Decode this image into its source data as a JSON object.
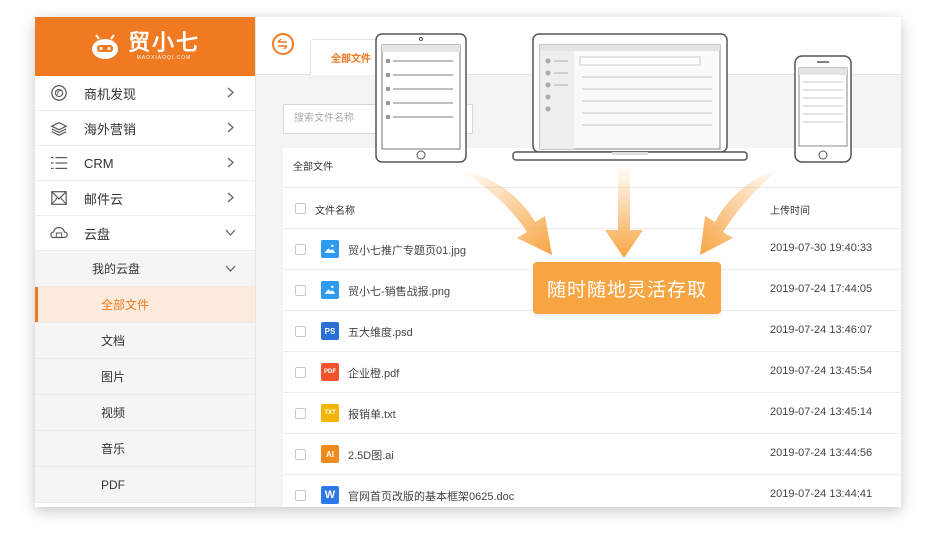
{
  "brand": {
    "name": "贸小七",
    "sub": "MAOXIAOQI.COM",
    "color": "#ef7a21"
  },
  "nav": [
    {
      "label": "商机发现",
      "icon": "compass-icon"
    },
    {
      "label": "海外营销",
      "icon": "layers-icon"
    },
    {
      "label": "CRM",
      "icon": "list-icon"
    },
    {
      "label": "邮件云",
      "icon": "mail-icon"
    },
    {
      "label": "云盘",
      "icon": "cloud-icon"
    }
  ],
  "submenu": {
    "parent": "我的云盘",
    "items": [
      "全部文件",
      "文档",
      "图片",
      "视频",
      "音乐",
      "PDF"
    ],
    "active": "全部文件"
  },
  "tab": {
    "label": "全部文件"
  },
  "search": {
    "placeholder": "搜索文件名称"
  },
  "breadcrumb": "全部文件",
  "table": {
    "headers": {
      "name": "文件名称",
      "time": "上传时间"
    },
    "rows": [
      {
        "name": "贸小七推广专题页01.jpg",
        "time": "2019-07-30 19:40:33",
        "type": "image",
        "icon_color": "#2d9cf0"
      },
      {
        "name": "贸小七-销售战报.png",
        "time": "2019-07-24 17:44:05",
        "type": "image",
        "icon_color": "#2d9cf0"
      },
      {
        "name": "五大维度.psd",
        "time": "2019-07-24 13:46:07",
        "type": "PS",
        "icon_color": "#2a6fd6"
      },
      {
        "name": "企业橙.pdf",
        "time": "2019-07-24 13:45:54",
        "type": "PDF",
        "icon_color": "#f0532b"
      },
      {
        "name": "报销单.txt",
        "time": "2019-07-24 13:45:14",
        "type": "TXT",
        "icon_color": "#f5b400"
      },
      {
        "name": "2.5D图.ai",
        "time": "2019-07-24 13:44:56",
        "type": "AI",
        "icon_color": "#f08a1c"
      },
      {
        "name": "官网首页改版的基本框架0625.doc",
        "time": "2019-07-24 13:44:41",
        "type": "W",
        "icon_color": "#2d79e8"
      }
    ]
  },
  "callout": {
    "text": "随时随地灵活存取",
    "color": "#f7a543"
  }
}
